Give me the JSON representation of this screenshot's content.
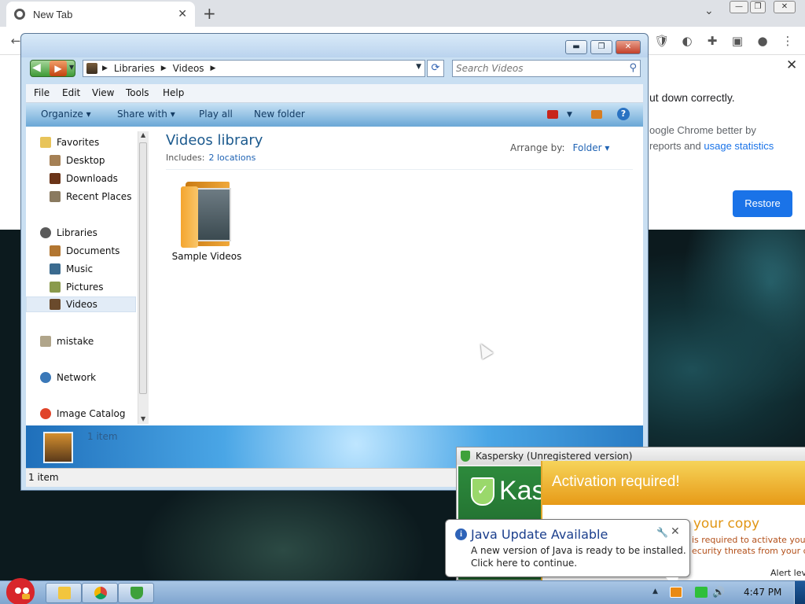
{
  "chrome": {
    "tab_title": "New Tab",
    "tab_close": "✕",
    "new_tab": "+",
    "tab_search": "⌄",
    "window_controls": [
      "—",
      "❐",
      "✕"
    ],
    "restore_panel": {
      "close": "✕",
      "line1": "ut down correctly.",
      "line2": "oogle Chrome better by",
      "line3_prefix": "reports and ",
      "line3_link": "usage statistics",
      "restore_label": "Restore"
    }
  },
  "explorer": {
    "address": {
      "crumbs": [
        "Libraries",
        "Videos"
      ]
    },
    "search_placeholder": "Search Videos",
    "menu": [
      "File",
      "Edit",
      "View",
      "Tools",
      "Help"
    ],
    "commands": {
      "organize": "Organize ▾",
      "share": "Share with ▾",
      "play_all": "Play all",
      "new_folder": "New folder",
      "help": "?"
    },
    "nav": {
      "favorites": "Favorites",
      "desktop": "Desktop",
      "downloads": "Downloads",
      "recent": "Recent Places",
      "libraries": "Libraries",
      "documents": "Documents",
      "music": "Music",
      "pictures": "Pictures",
      "videos": "Videos",
      "mistake": "mistake",
      "network": "Network",
      "image_catalog": "Image Catalog"
    },
    "library": {
      "title": "Videos library",
      "includes_label": "Includes:",
      "locations": "2 locations",
      "arrange_label": "Arrange by:",
      "arrange_value": "Folder ▾"
    },
    "items": [
      {
        "label": "Sample Videos"
      }
    ],
    "details_count": "1 item",
    "status_count": "1 item"
  },
  "kaspersky": {
    "window_title": "Kaspersky (Unregistered version)",
    "brand": "Kas",
    "activation_header": "Activation required!",
    "activation_sub": "e your copy",
    "activation_line1": "is required to activate your c",
    "activation_line2": "ecurity threats from your com",
    "alert_level": "Alert leve"
  },
  "java": {
    "title": "Java Update Available",
    "line1": "A new version of Java is ready to be installed.",
    "line2": "Click here to continue.",
    "close": "✕"
  },
  "taskbar": {
    "clock": "4:47 PM"
  },
  "colors": {
    "chrome_blue": "#1a73e8",
    "explorer_title": "#1c5a8e",
    "kaspersky_green": "#2d8a3c",
    "activation_orange": "#e79a17",
    "java_title": "#1a3e8c"
  }
}
